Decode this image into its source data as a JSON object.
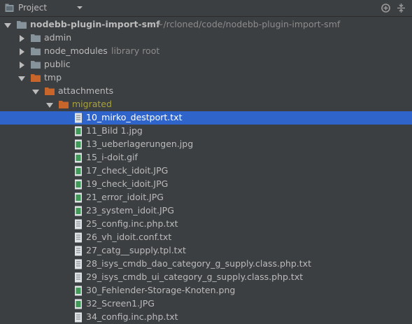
{
  "header": {
    "title": "Project",
    "icons": [
      "settings-icon",
      "collapse-icon"
    ]
  },
  "tree": {
    "root": {
      "name": "nodebb-plugin-import-smf",
      "path": "~/rcloned/code/nodebb-plugin-import-smf"
    },
    "folders": {
      "admin": "admin",
      "node_modules": "node_modules",
      "node_modules_hint": "library root",
      "public": "public",
      "tmp": "tmp",
      "attachments": "attachments",
      "migrated": "migrated"
    },
    "files": [
      "10_mirko_destport.txt",
      "11_Bild 1.jpg",
      "13_ueberlagerungen.jpg",
      "15_i-doit.gif",
      "17_check_idoit.JPG",
      "19_check_idoit.JPG",
      "21_error_idoit.JPG",
      "23_system_idoit.JPG",
      "25_config.inc.php.txt",
      "26_vh_idoit.conf.txt",
      "27_catg__supply.tpl.txt",
      "28_isys_cmdb_dao_category_g_supply.class.php.txt",
      "29_isys_cmdb_ui_category_g_supply.class.php.txt",
      "30_Fehlender-Storage-Knoten.png",
      "32_Screen1.JPG",
      "34_config.inc.php.txt"
    ],
    "selected_file": "10_mirko_destport.txt"
  },
  "colors": {
    "background": "#3c3f41",
    "selection": "#2f65ca",
    "folder_gray": "#87939a",
    "folder_orange": "#c7652a",
    "migrated_text": "#a9a23a"
  }
}
